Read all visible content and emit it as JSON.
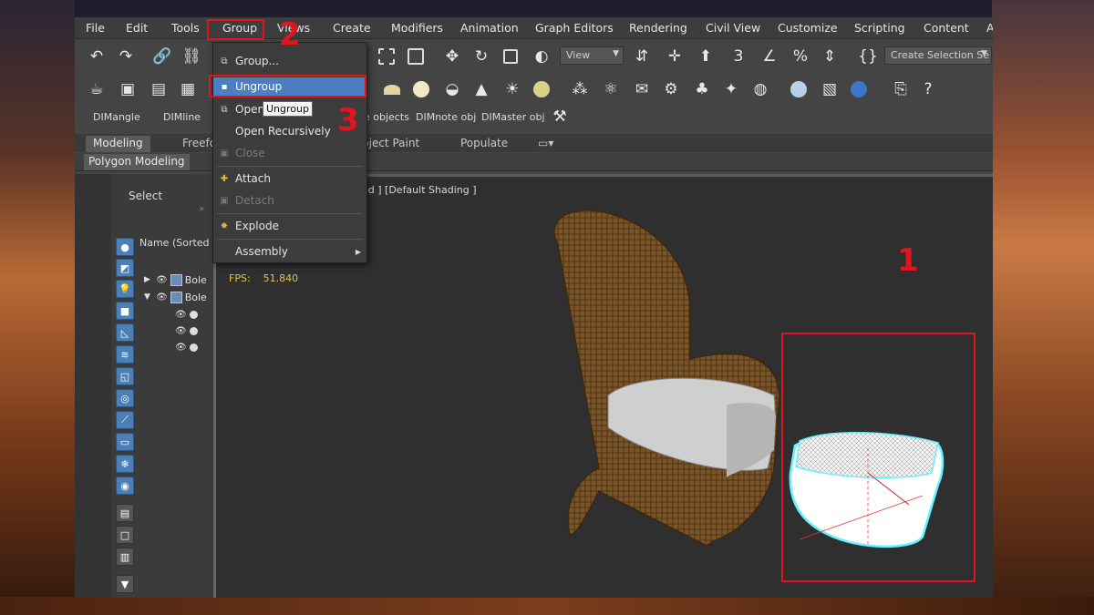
{
  "menu": [
    "File",
    "Edit",
    "Tools",
    "Group",
    "Views",
    "Create",
    "Modifiers",
    "Animation",
    "Graph Editors",
    "Rendering",
    "Civil View",
    "Customize",
    "Scripting",
    "Content",
    "A"
  ],
  "toolbar": {
    "view_dropdown": "View",
    "selection_set": "Create Selection Se"
  },
  "commands": [
    "DIMangle",
    "DIMline",
    "ne objects",
    "DIMnote obj",
    "DIMaster obj"
  ],
  "ribbon": {
    "tabs": [
      "Modeling",
      "Freefo",
      "bject Paint",
      "Populate"
    ],
    "subtab": "Polygon Modeling"
  },
  "scene_explorer": {
    "title": "Select",
    "column_header": "Name (Sorted A",
    "rows": [
      "Bole",
      "Bole"
    ]
  },
  "viewport": {
    "label": "ed ] [Default Shading ]",
    "fps_label": "FPS:",
    "fps_value": "51.840"
  },
  "group_menu": {
    "items": [
      {
        "label": "Group...",
        "icon": "group-icon"
      },
      {
        "label": "Ungroup",
        "icon": "ungroup-icon"
      },
      {
        "label": "Open",
        "icon": "open-icon"
      },
      {
        "label": "Open Recursively",
        "icon": ""
      },
      {
        "label": "Close",
        "icon": "close-icon"
      },
      {
        "label": "Attach",
        "icon": "attach-icon"
      },
      {
        "label": "Detach",
        "icon": "detach-icon"
      },
      {
        "label": "Explode",
        "icon": "explode-icon"
      },
      {
        "label": "Assembly",
        "icon": ""
      }
    ],
    "tooltip": "Ungroup"
  },
  "annotations": {
    "step1": "1",
    "step2": "2",
    "step3": "3"
  },
  "colors": {
    "highlight": "#4d7fc0",
    "annotation_red": "#e0151e",
    "selection_cyan": "#5ff2ff"
  }
}
